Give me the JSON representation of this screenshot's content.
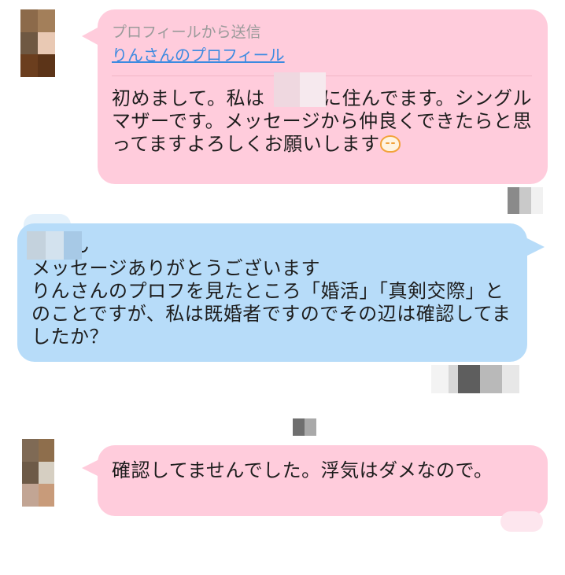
{
  "messages": [
    {
      "sender": "partner",
      "header": "プロフィールから送信",
      "profile_link": "りんさんのプロフィール",
      "text": "初めまして。私は　　市に住んでます。シングルマザーです。メッセージから仲良くできたらと思ってますよろしくお願いします"
    },
    {
      "sender": "self",
      "text": "　さん\nメッセージありがとうございます\nりんさんのプロフを見たところ「婚活」「真剣交際」とのことですが、私は既婚者ですのでその辺は確認してましたか？"
    },
    {
      "sender": "partner",
      "text": "確認してませんでした。浮気はダメなので。"
    }
  ],
  "colors": {
    "incoming_bubble": "#ffccdc",
    "outgoing_bubble": "#b7dcf9",
    "link": "#3c8ae0",
    "header_gray": "#9a9a9a"
  },
  "icons": [
    "avatar-mosaic",
    "bowing-emoji"
  ]
}
